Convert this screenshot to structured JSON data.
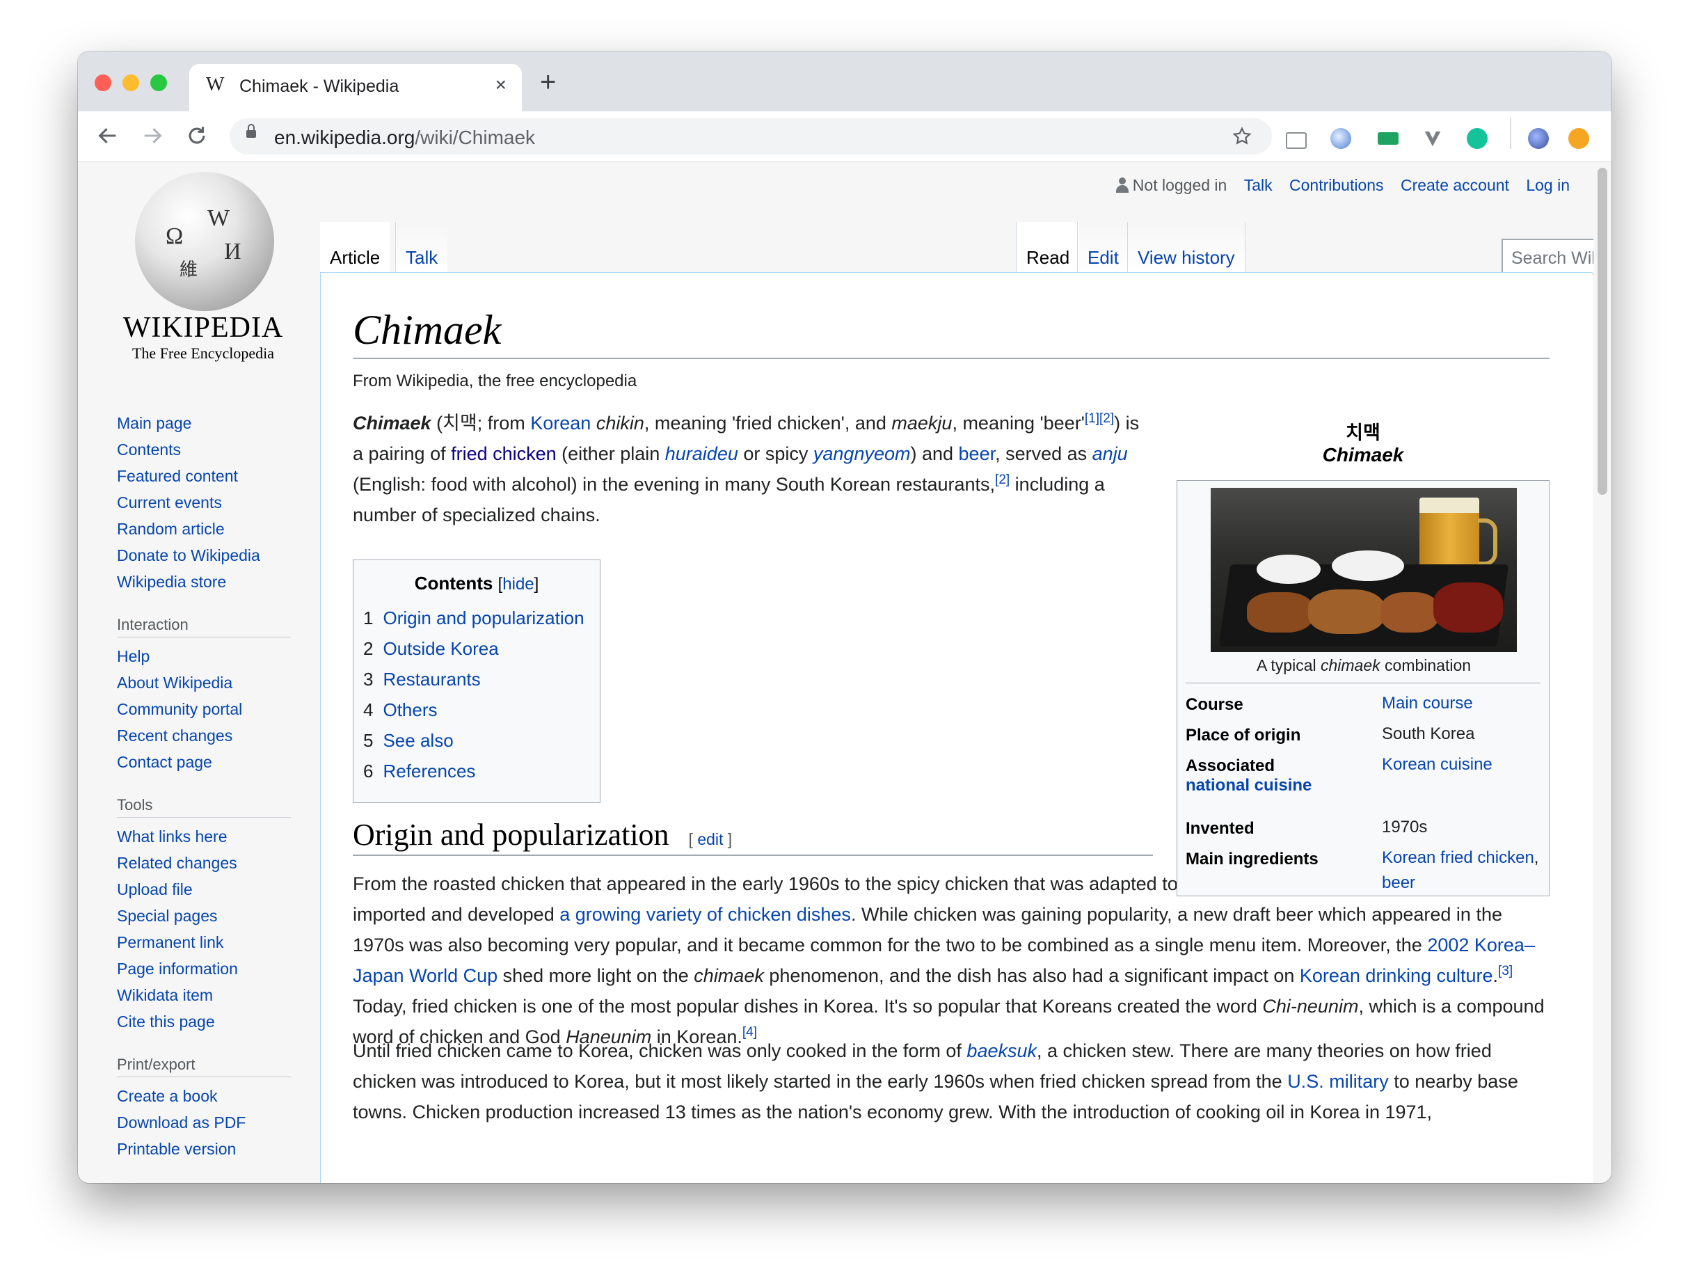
{
  "browser": {
    "tab_title": "Chimaek - Wikipedia",
    "tab_favicon": "W",
    "tab_close": "×",
    "new_tab": "+",
    "url_host": "en.wikipedia.org",
    "url_path": "/wiki/Chimaek",
    "nav_icons": [
      "back-arrow-icon",
      "forward-arrow-icon",
      "reload-icon"
    ],
    "traffic_lights": [
      "#ff5f57",
      "#febc2e",
      "#28c840"
    ]
  },
  "wiki": {
    "wordmark": "WIKIPEDIA",
    "tagline": "The Free Encyclopedia",
    "personal": {
      "not_logged_in": "Not logged in",
      "links": [
        "Talk",
        "Contributions",
        "Create account",
        "Log in"
      ]
    },
    "tabs_left": [
      "Article",
      "Talk"
    ],
    "tabs_right": [
      "Read",
      "Edit",
      "View history"
    ],
    "search_placeholder": "Search Wikipedia",
    "sidebar": {
      "nav": [
        "Main page",
        "Contents",
        "Featured content",
        "Current events",
        "Random article",
        "Donate to Wikipedia",
        "Wikipedia store"
      ],
      "interaction_head": "Interaction",
      "interaction": [
        "Help",
        "About Wikipedia",
        "Community portal",
        "Recent changes",
        "Contact page"
      ],
      "tools_head": "Tools",
      "tools": [
        "What links here",
        "Related changes",
        "Upload file",
        "Special pages",
        "Permanent link",
        "Page information",
        "Wikidata item",
        "Cite this page"
      ],
      "print_head": "Print/export",
      "print": [
        "Create a book",
        "Download as PDF",
        "Printable version"
      ]
    }
  },
  "article": {
    "title": "Chimaek",
    "from": "From Wikipedia, the free encyclopedia",
    "toc": {
      "title": "Contents",
      "hide": "hide",
      "items": [
        {
          "num": "1",
          "label": "Origin and popularization"
        },
        {
          "num": "2",
          "label": "Outside Korea"
        },
        {
          "num": "3",
          "label": "Restaurants"
        },
        {
          "num": "4",
          "label": "Others"
        },
        {
          "num": "5",
          "label": "See also"
        },
        {
          "num": "6",
          "label": "References"
        }
      ]
    },
    "section1_heading": "Origin and popularization",
    "edit_link": "edit",
    "infobox": {
      "name_ko": "치맥",
      "name_en": "Chimaek",
      "caption_pre": "A typical ",
      "caption_em": "chimaek",
      "caption_post": " combination",
      "rows": {
        "course_label": "Course",
        "course_value": "Main course",
        "origin_label": "Place of origin",
        "origin_value": "South Korea",
        "assoc_label1": "Associated",
        "assoc_label2": "national cuisine",
        "assoc_value": "Korean cuisine",
        "invented_label": "Invented",
        "invented_value": "1970s",
        "ingredients_label": "Main ingredients",
        "ingredients_value1": "Korean fried chicken",
        "ingredients_value2": "beer"
      }
    },
    "p1": {
      "t1": "Chimaek",
      "t2": " (치맥; from ",
      "t3": "Korean",
      "t4": " ",
      "t5": "chikin",
      "t6": ", meaning 'fried chicken', and ",
      "t7": "maekju",
      "t8": ", meaning 'beer'",
      "t9": "[1]",
      "t10": "[2]",
      "t11": ") is a pairing of ",
      "t12": "fried chicken",
      "t13": " (either plain ",
      "t14": "huraideu",
      "t15": " or spicy ",
      "t16": "yangnyeom",
      "t17": ") and ",
      "t18": "beer",
      "t19": ", served as ",
      "t20": "anju",
      "t21": " (English: food with alcohol) in the evening in many South Korean restaurants,",
      "t22": "[2]",
      "t23": " including a number of specialized chains."
    },
    "p2": {
      "t1": "From the roasted chicken that appeared in the early 1960s to the spicy chicken that was adapted to meet Korean tastes, South Korea has imported and developed ",
      "t2": "a growing variety of chicken dishes",
      "t3": ". While chicken was gaining popularity, a new draft beer which appeared in the 1970s was also becoming very popular, and it became common for the two to be combined as a single menu item. Moreover, the ",
      "t4": "2002 Korea–Japan World Cup",
      "t5": " shed more light on the ",
      "t6": "chimaek",
      "t7": " phenomenon, and the dish has also had a significant impact on ",
      "t8": "Korean drinking culture",
      "t9": ".",
      "t10": "[3]",
      "t11": " Today, fried chicken is one of the most popular dishes in Korea. It's so popular that Koreans created the word ",
      "t12": "Chi-neunim",
      "t13": ", which is a compound word of chicken and God ",
      "t14": "Haneunim",
      "t15": " in Korean.",
      "t16": "[4]"
    },
    "p3": {
      "t1": "Until fried chicken came to Korea, chicken was only cooked in the form of ",
      "t2": "baeksuk",
      "t3": ", a chicken stew. There are many theories on how fried chicken was introduced to Korea, but it most likely started in the early 1960s when fried chicken spread from the ",
      "t4": "U.S. military",
      "t5": " to nearby base towns. Chicken production increased 13 times as the nation's economy grew. With the introduction of cooking oil in Korea in 1971,"
    }
  }
}
